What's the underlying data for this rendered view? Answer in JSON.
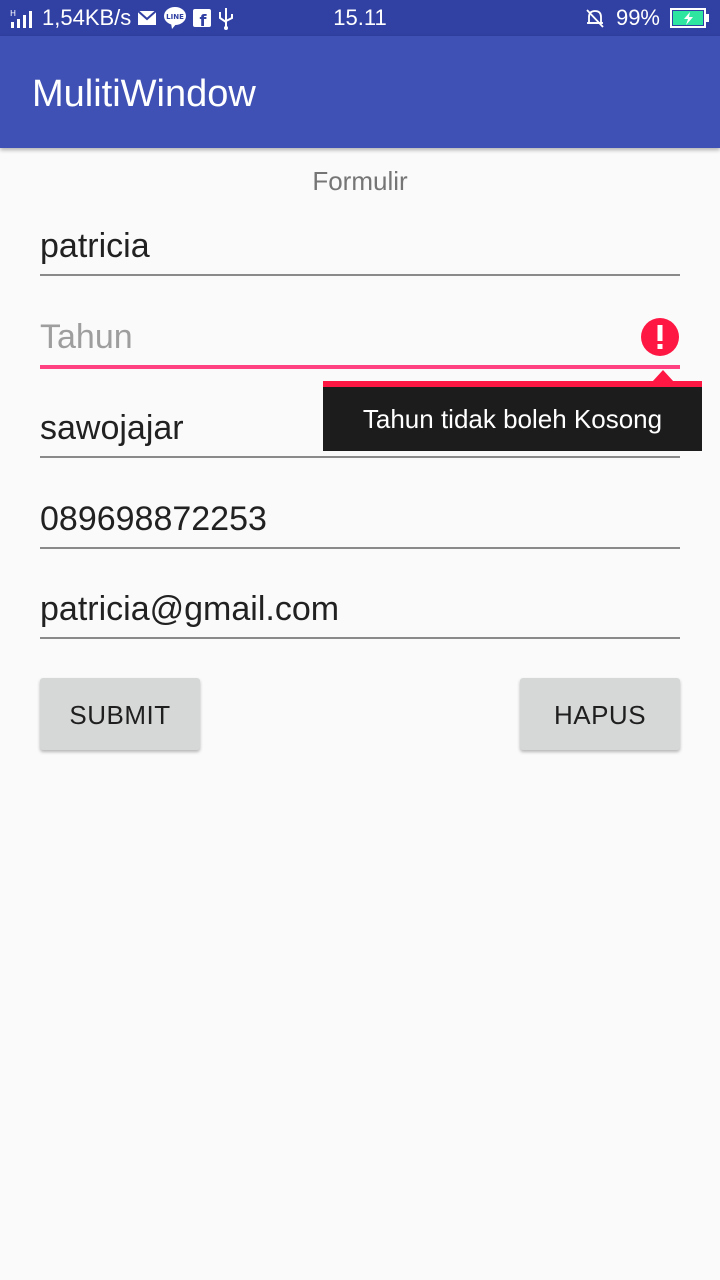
{
  "status_bar": {
    "network_speed": "1,54KB/s",
    "time": "15.11",
    "battery": "99%",
    "icons": [
      "hplus-icon",
      "signal-icon",
      "mail-icon",
      "line-app-icon",
      "facebook-icon",
      "usb-icon",
      "bell-muted-icon",
      "battery-charging-icon"
    ]
  },
  "app_bar": {
    "title": "MulitiWindow"
  },
  "form": {
    "heading": "Formulir",
    "name_value": "patricia",
    "year_placeholder": "Tahun",
    "address_value": "sawojajar",
    "phone_value": "089698872253",
    "email_value": "patricia@gmail.com",
    "error_message": "Tahun tidak boleh Kosong"
  },
  "buttons": {
    "submit": "SUBMIT",
    "clear": "HAPUS"
  },
  "colors": {
    "status_bar": "#3140a3",
    "app_bar": "#3f51b5",
    "accent": "#ff4081",
    "error": "#ff1744",
    "button_bg": "#d6d7d7"
  }
}
